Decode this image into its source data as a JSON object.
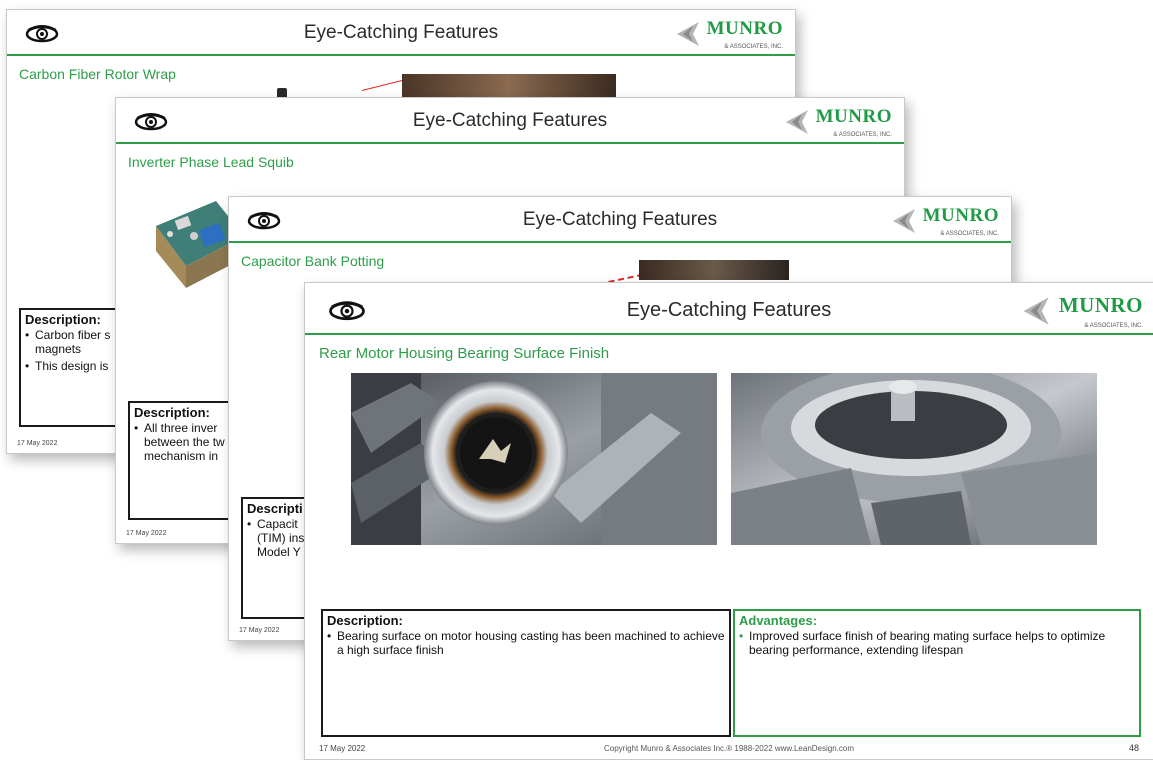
{
  "slides": [
    {
      "header_title": "Eye-Catching Features",
      "subtitle": "Carbon Fiber Rotor Wrap",
      "description_title": "Description:",
      "bullets": [
        "Carbon fiber s magnets",
        "This design is"
      ],
      "date": "17 May 2022"
    },
    {
      "header_title": "Eye-Catching Features",
      "subtitle": "Inverter Phase Lead Squib",
      "description_title": "Description:",
      "bullets": [
        "All three inver between the tw mechanism in"
      ],
      "date": "17 May 2022"
    },
    {
      "header_title": "Eye-Catching Features",
      "subtitle": "Capacitor Bank Potting",
      "description_title": "Descripti",
      "bullets": [
        "Capacit (TIM) ins Model Y"
      ],
      "date": "17 May 2022"
    },
    {
      "header_title": "Eye-Catching Features",
      "subtitle": "Rear Motor Housing Bearing Surface Finish",
      "description_title": "Description:",
      "bullets": [
        "Bearing surface on motor housing casting has been machined to achieve a high surface finish"
      ],
      "advantages_title": "Advantages:",
      "advantages_bullets": [
        "Improved surface finish of bearing mating surface helps to optimize bearing performance, extending lifespan"
      ],
      "date": "17 May 2022",
      "copyright": "Copyright Munro & Associates Inc.® 1988-2022   www.LeanDesign.com",
      "page_number": "48"
    }
  ],
  "logo": {
    "name": "MUNRO",
    "tagline": "& ASSOCIATES, INC."
  },
  "colors": {
    "accent_green": "#2e9d4a",
    "logo_green": "#1f9a45",
    "box_border": "#1a1a1a",
    "callout_red": "#dd2222"
  },
  "icons": [
    "eye-icon",
    "munro-logo",
    "bullet-icon"
  ]
}
